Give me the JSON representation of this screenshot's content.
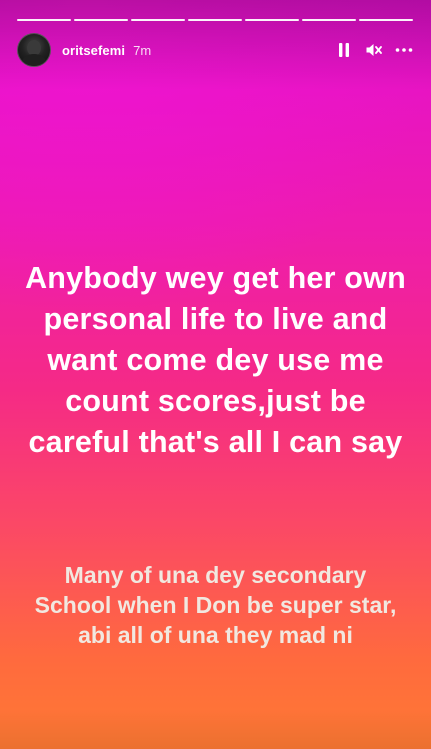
{
  "story": {
    "progress_segments": 7,
    "header": {
      "username": "oritsefemi",
      "time": "7m",
      "pause_icon": "pause-icon",
      "mute_icon": "speaker-muted-icon",
      "more_icon": "more-horizontal-icon"
    },
    "main_text": "Anybody wey get her own personal life to live and want come dey use me count scores,just be careful that's all I can say",
    "sub_text": "Many of una dey secondary School when I Don be super star, abi all of una they mad ni",
    "colors": {
      "gradient_top": "#e30fd0",
      "gradient_middle": "#f52a86",
      "gradient_bottom": "#ff7a33",
      "main_text": "#ffffff",
      "sub_text": "#f1e8e0"
    }
  }
}
